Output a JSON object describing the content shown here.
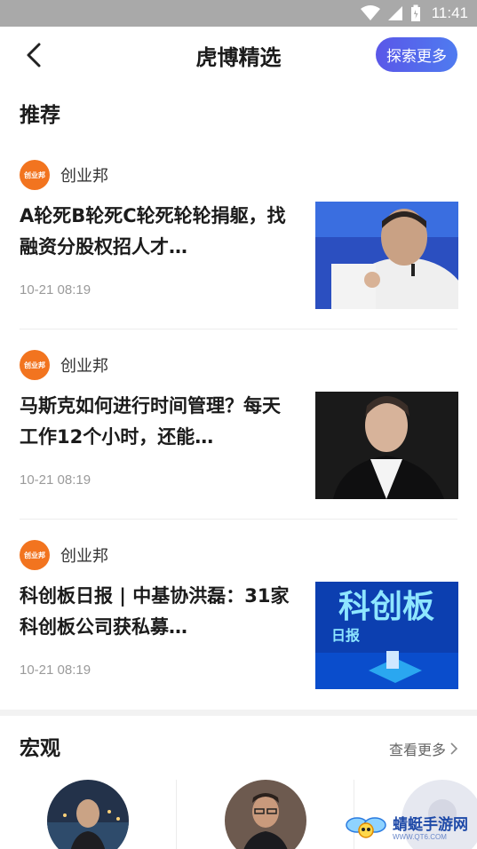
{
  "status_bar": {
    "time": "11:41"
  },
  "header": {
    "title": "虎博精选",
    "explore_label": "探索更多"
  },
  "recommend": {
    "section_title": "推荐",
    "articles": [
      {
        "source_logo": "创业邦",
        "source": "创业邦",
        "title": "A轮死B轮死C轮死轮轮捐躯，找融资分股权招人才…",
        "time": "10-21 08:19"
      },
      {
        "source_logo": "创业邦",
        "source": "创业邦",
        "title": "马斯克如何进行时间管理？每天工作12个小时，还能…",
        "time": "10-21 08:19"
      },
      {
        "source_logo": "创业邦",
        "source": "创业邦",
        "title": "科创板日报 | 中基协洪磊：31家科创板公司获私募…",
        "time": "10-21 08:19"
      }
    ],
    "thumb3_text": {
      "big": "科创板",
      "small": "日报"
    }
  },
  "macro": {
    "section_title": "宏观",
    "more_label": "查看更多"
  },
  "watermark": {
    "name": "蜻蜓手游网",
    "url": "WWW.QT6.COM"
  }
}
